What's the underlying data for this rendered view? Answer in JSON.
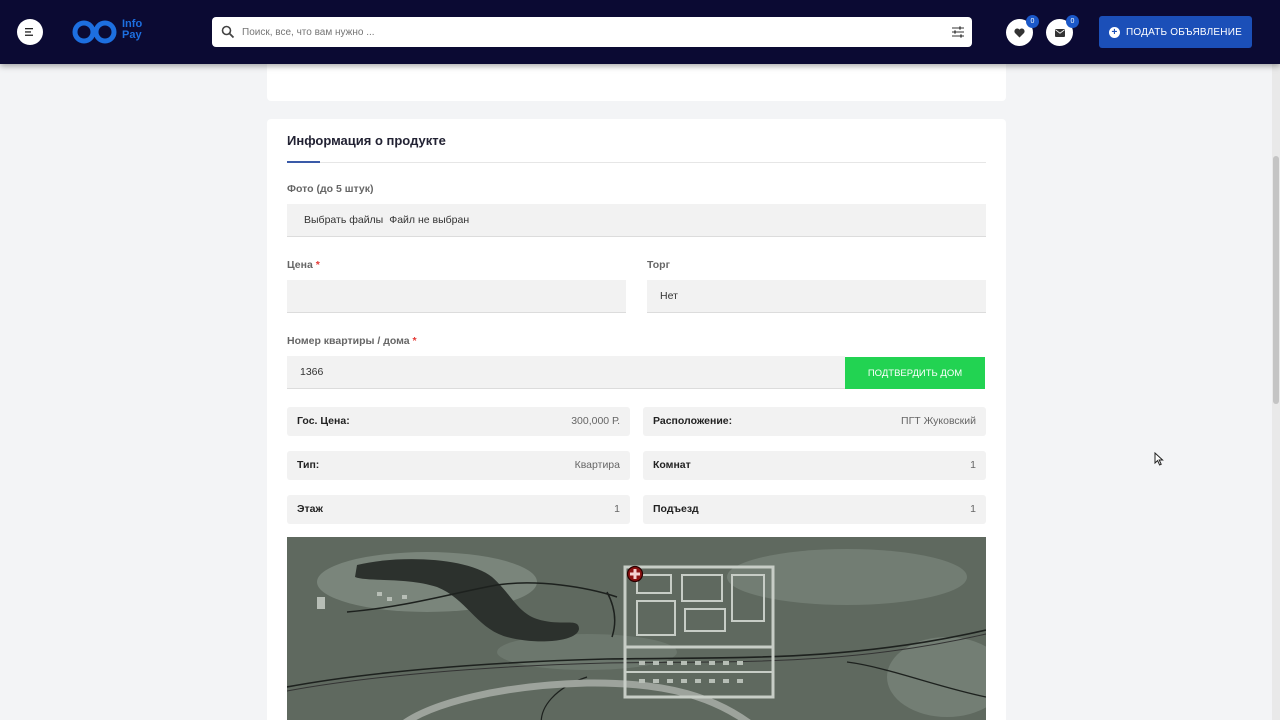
{
  "header": {
    "logo_text_line1": "Info",
    "logo_text_line2": "Pay",
    "search_placeholder": "Поиск, все, что вам нужно ...",
    "favorites_count": "0",
    "messages_count": "0",
    "post_button_label": "ПОДАТЬ ОБЪЯВЛЕНИЕ",
    "brand_color": "#1b4fb8",
    "topbar_color": "#0b0a33"
  },
  "form": {
    "section_title": "Информация о продукте",
    "photo_label": "Фото (до 5 штук)",
    "file_button": "Выбрать файлы",
    "file_status": "Файл не выбран",
    "price_label": "Цена",
    "price_value": "",
    "bargain_label": "Торг",
    "bargain_value": "Нет",
    "house_label": "Номер квартиры / дома",
    "house_value": "1366",
    "required_mark": "*",
    "confirm_button": "ПОДТВЕРДИТЬ ДОМ",
    "confirm_color": "#22d352"
  },
  "details": [
    {
      "key": "Гос. Цена:",
      "value": "300,000 Р."
    },
    {
      "key": "Расположение:",
      "value": "ПГТ Жуковский"
    },
    {
      "key": "Тип:",
      "value": "Квартира"
    },
    {
      "key": "Комнат",
      "value": "1"
    },
    {
      "key": "Этаж",
      "value": "1"
    },
    {
      "key": "Подъезд",
      "value": "1"
    }
  ],
  "icons": [
    "menu-icon",
    "logo-icon",
    "search-icon",
    "filter-icon",
    "heart-icon",
    "envelope-icon",
    "plus-circle-icon",
    "map-marker-icon",
    "cursor-icon"
  ]
}
